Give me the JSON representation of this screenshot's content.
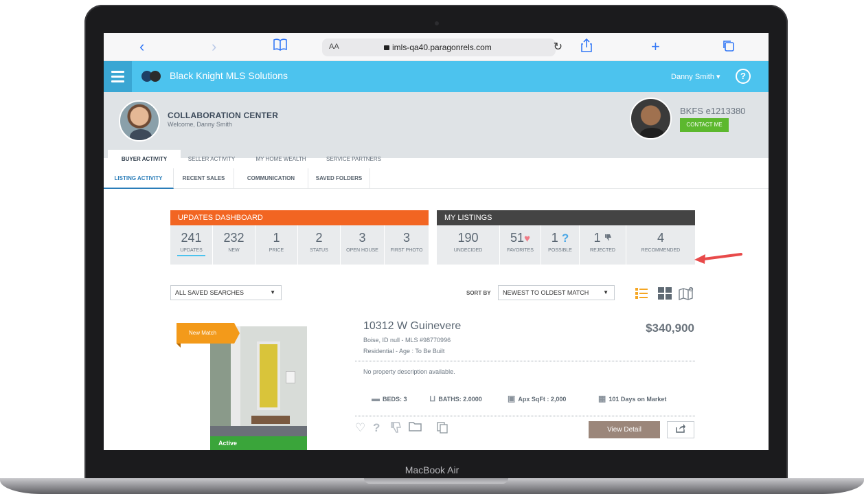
{
  "device": {
    "model": "MacBook Air"
  },
  "browser": {
    "text_size_label": "AA",
    "url": "imls-qa40.paragonrels.com"
  },
  "app": {
    "brand": "Black Knight MLS Solutions",
    "user_menu": "Danny Smith ▾",
    "help": "?",
    "colors": {
      "bar": "#4cc3ee",
      "accent_orange": "#f26522",
      "dark": "#444444",
      "green": "#5cb82e"
    }
  },
  "header": {
    "title": "COLLABORATION CENTER",
    "welcome": "Welcome, Danny Smith",
    "agent_id": "BKFS e1213380",
    "contact_label": "CONTACT ME"
  },
  "tabs_primary": [
    {
      "label": "BUYER ACTIVITY",
      "active": true
    },
    {
      "label": "SELLER ACTIVITY",
      "active": false
    },
    {
      "label": "MY HOME WEALTH",
      "active": false
    },
    {
      "label": "SERVICE PARTNERS",
      "active": false
    }
  ],
  "tabs_secondary": [
    {
      "label": "LISTING ACTIVITY",
      "active": true
    },
    {
      "label": "RECENT SALES",
      "active": false
    },
    {
      "label": "COMMUNICATION",
      "active": false
    },
    {
      "label": "SAVED FOLDERS",
      "active": false
    }
  ],
  "updates_dashboard": {
    "title": "UPDATES DASHBOARD",
    "stats": [
      {
        "value": "241",
        "label": "UPDATES",
        "selected": true
      },
      {
        "value": "232",
        "label": "NEW"
      },
      {
        "value": "1",
        "label": "PRICE"
      },
      {
        "value": "2",
        "label": "STATUS"
      },
      {
        "value": "3",
        "label": "OPEN HOUSE"
      },
      {
        "value": "3",
        "label": "FIRST PHOTO"
      }
    ]
  },
  "my_listings": {
    "title": "MY LISTINGS",
    "stats": [
      {
        "value": "190",
        "label": "UNDECIDED",
        "icon": ""
      },
      {
        "value": "51",
        "label": "FAVORITES",
        "icon": "heart-icon"
      },
      {
        "value": "1",
        "label": "POSSIBLE",
        "icon": "question-icon"
      },
      {
        "value": "1",
        "label": "REJECTED",
        "icon": "thumbs-down-icon"
      },
      {
        "value": "4",
        "label": "RECOMMENDED",
        "icon": ""
      }
    ]
  },
  "controls": {
    "saved_search": "ALL SAVED SEARCHES",
    "sort_by_label": "SORT BY",
    "sort_value": "NEWEST TO OLDEST MATCH"
  },
  "listing": {
    "ribbon": "New Match",
    "status": "Active",
    "address": "10312 W Guinevere",
    "price": "$340,900",
    "location": "Boise, ID null - MLS #98770996",
    "type": "Residential  -  Age : To Be Built",
    "description": "No property description available.",
    "beds": "BEDS: 3",
    "baths": "BATHS: 2.0000",
    "sqft": "Apx SqFt : 2,000",
    "dom": "101 Days on Market",
    "view_detail": "View Detail"
  }
}
